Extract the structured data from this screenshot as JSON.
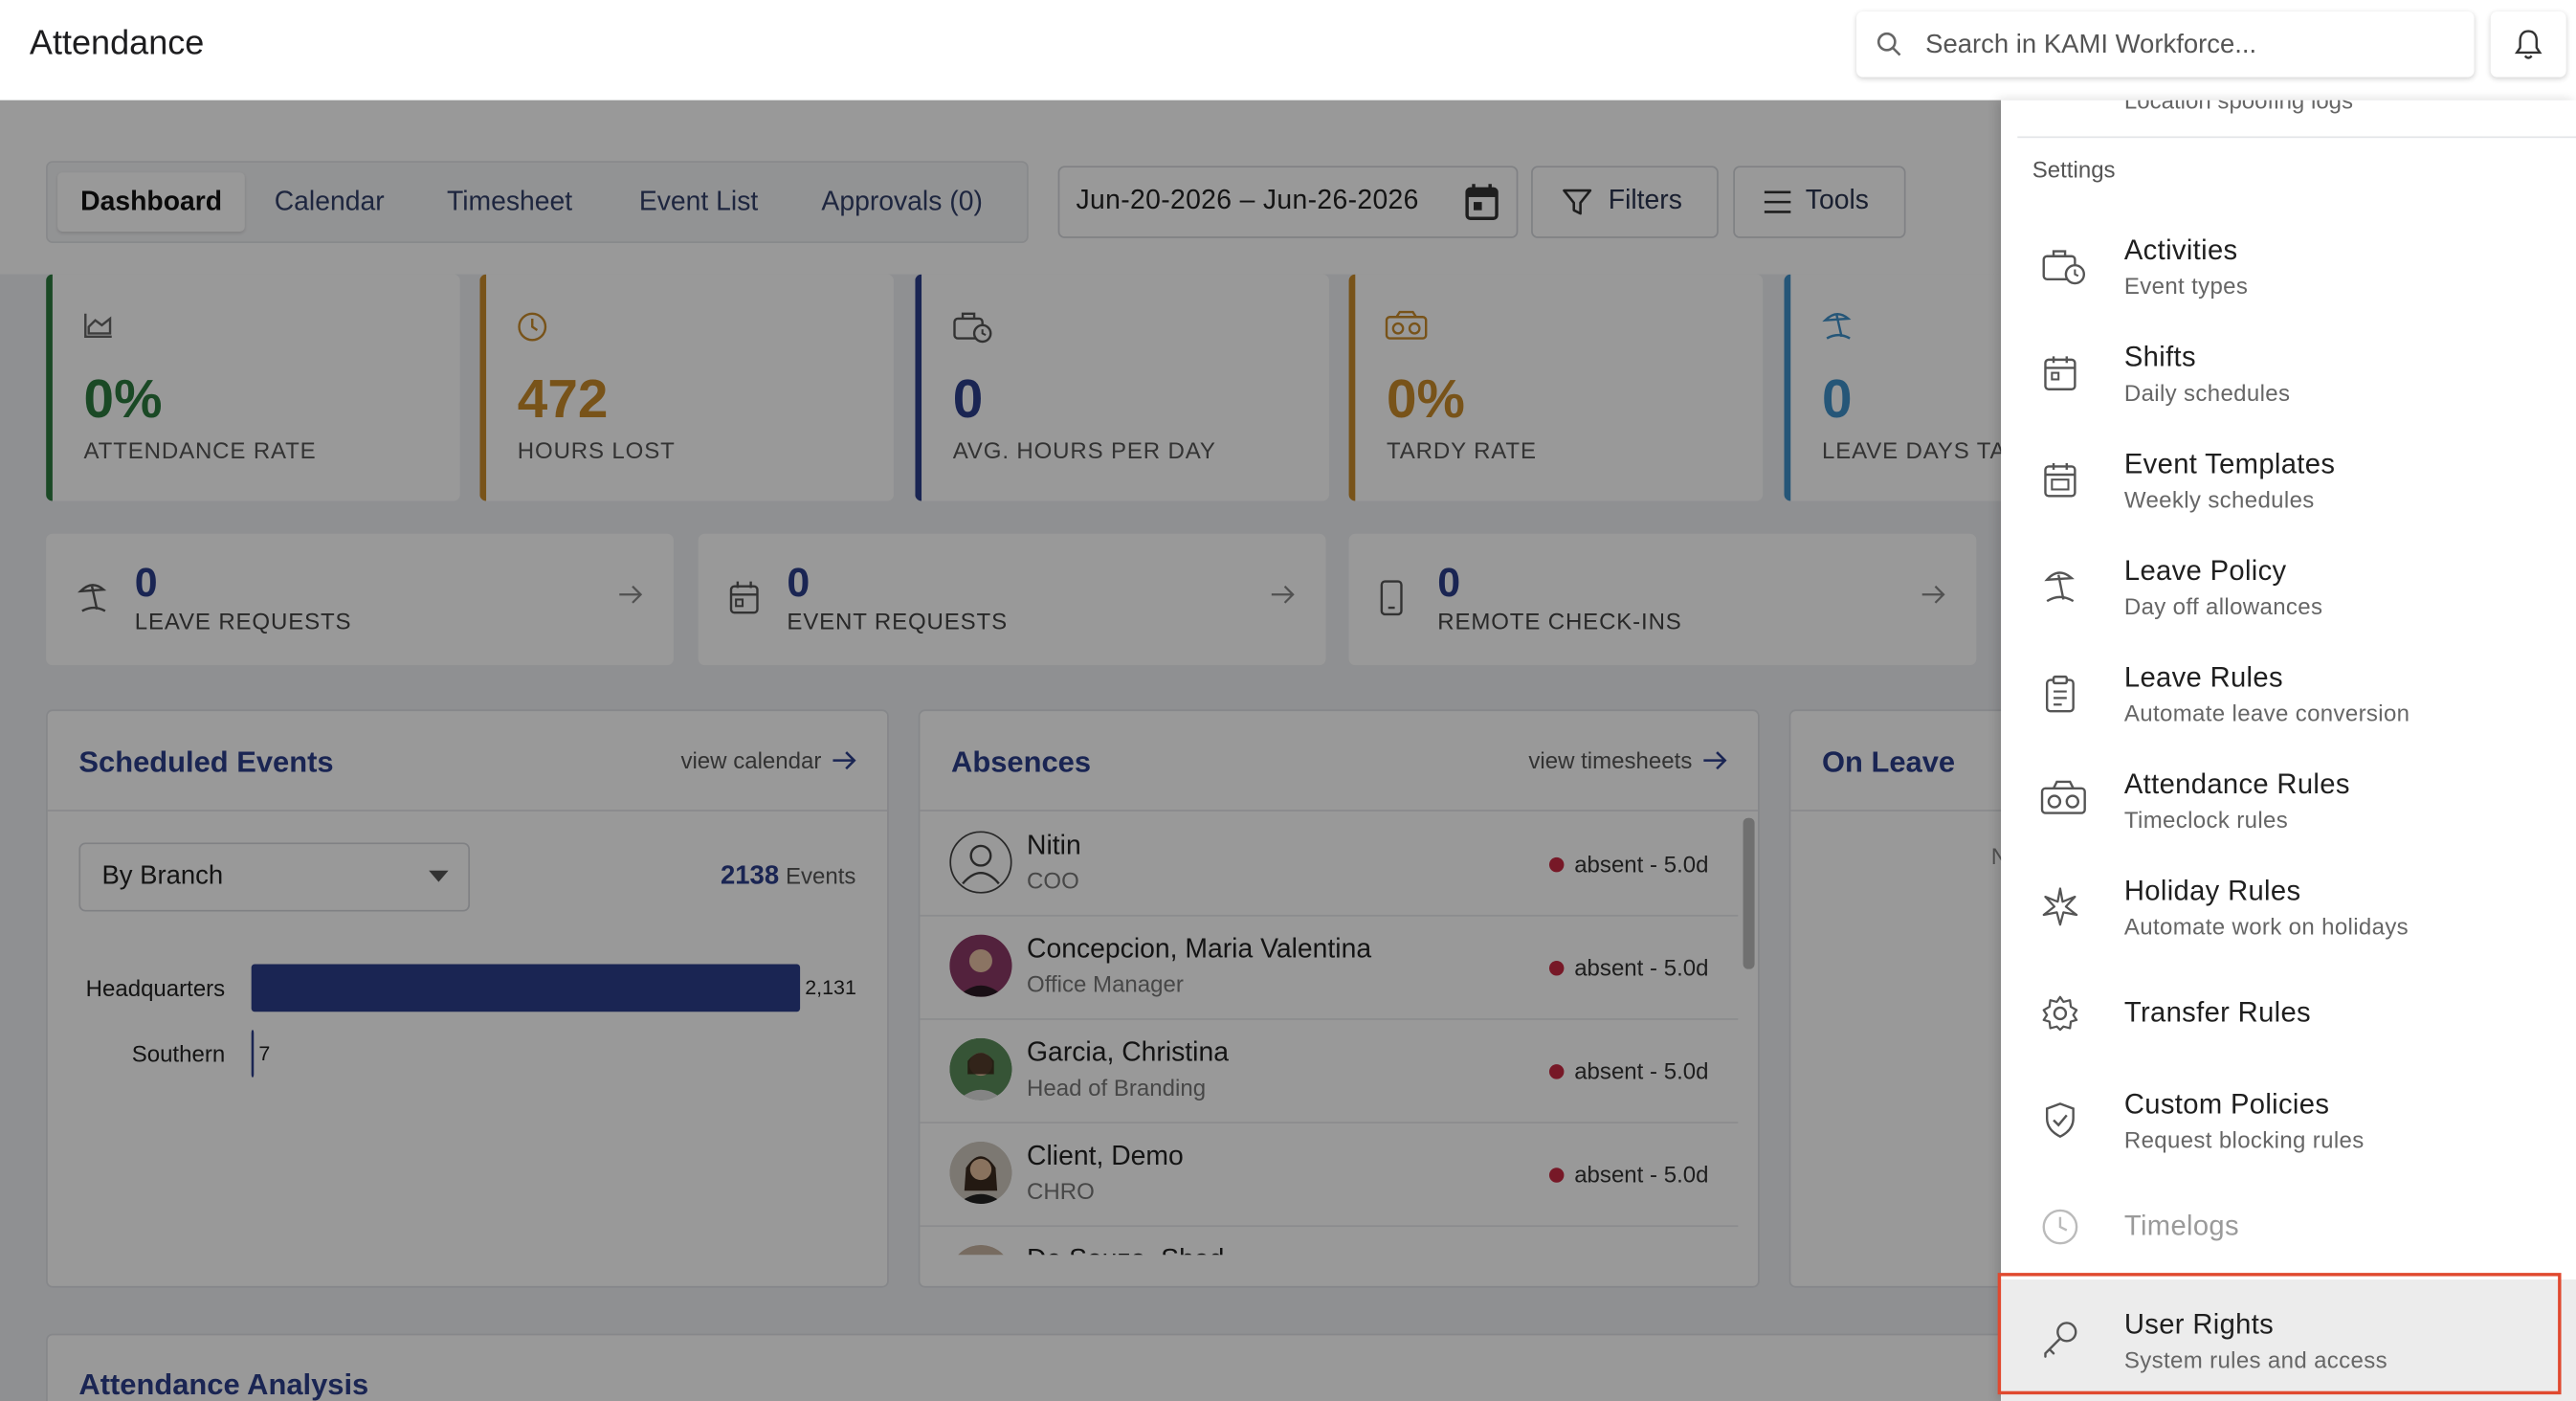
{
  "header": {
    "title": "Attendance",
    "search_placeholder": "Search in KAMI Workforce..."
  },
  "tabs": [
    {
      "label": "Dashboard",
      "active": true
    },
    {
      "label": "Calendar"
    },
    {
      "label": "Timesheet"
    },
    {
      "label": "Event List"
    },
    {
      "label": "Approvals (0)"
    }
  ],
  "toolbar": {
    "date_range": "Jun-20-2026 – Jun-26-2026",
    "filters_label": "Filters",
    "tools_label": "Tools"
  },
  "kpis": [
    {
      "value": "0%",
      "label": "ATTENDANCE RATE",
      "color": "#2c7a3f",
      "icon": "chart-area-icon"
    },
    {
      "value": "472",
      "label": "HOURS LOST",
      "color": "#c98a2b",
      "icon": "clock-icon"
    },
    {
      "value": "0",
      "label": "AVG. HOURS PER DAY",
      "color": "#2c3e8a",
      "icon": "briefcase-clock-icon"
    },
    {
      "value": "0%",
      "label": "TARDY RATE",
      "color": "#c98a2b",
      "icon": "cassette-icon"
    },
    {
      "value": "0",
      "label": "LEAVE DAYS TAK",
      "color": "#3f8fc9",
      "icon": "beach-icon"
    }
  ],
  "requests": [
    {
      "value": "0",
      "label": "LEAVE REQUESTS",
      "icon": "beach-icon"
    },
    {
      "value": "0",
      "label": "EVENT REQUESTS",
      "icon": "calendar-icon"
    },
    {
      "value": "0",
      "label": "REMOTE CHECK-INS",
      "icon": "phone-icon"
    }
  ],
  "scheduled": {
    "title": "Scheduled Events",
    "link": "view calendar",
    "select_value": "By Branch",
    "events_count": "2138",
    "events_label": "Events"
  },
  "chart_data": {
    "type": "bar",
    "orientation": "horizontal",
    "categories": [
      "Headquarters",
      "Southern"
    ],
    "values": [
      2131,
      7
    ],
    "value_labels": [
      "2,131",
      "7"
    ],
    "xlim": [
      0,
      2131
    ],
    "bar_color": "#2c3e8a"
  },
  "absences": {
    "title": "Absences",
    "link": "view timesheets",
    "status_text": "absent - 5.0d",
    "rows": [
      {
        "name": "Nitin",
        "role": "COO"
      },
      {
        "name": "Concepcion, Maria Valentina",
        "role": "Office Manager"
      },
      {
        "name": "Garcia, Christina",
        "role": "Head of Branding"
      },
      {
        "name": "Client, Demo",
        "role": "CHRO"
      },
      {
        "name": "De Souza, Shad",
        "role": ""
      }
    ]
  },
  "on_leave": {
    "title": "On Leave",
    "partial": "N"
  },
  "analysis": {
    "title": "Attendance Analysis"
  },
  "panel": {
    "cut_text": "Location spoofing logs",
    "section": "Settings",
    "items": [
      {
        "title": "Activities",
        "subtitle": "Event types",
        "icon": "briefcase-clock-icon"
      },
      {
        "title": "Shifts",
        "subtitle": "Daily schedules",
        "icon": "calendar-icon"
      },
      {
        "title": "Event Templates",
        "subtitle": "Weekly schedules",
        "icon": "calendar-template-icon"
      },
      {
        "title": "Leave Policy",
        "subtitle": "Day off allowances",
        "icon": "beach-icon"
      },
      {
        "title": "Leave Rules",
        "subtitle": "Automate leave conversion",
        "icon": "clipboard-list-icon"
      },
      {
        "title": "Attendance Rules",
        "subtitle": "Timeclock rules",
        "icon": "cassette-icon"
      },
      {
        "title": "Holiday Rules",
        "subtitle": "Automate work on holidays",
        "icon": "sparkle-icon"
      },
      {
        "title": "Transfer Rules",
        "subtitle": "",
        "icon": "gear-icon"
      },
      {
        "title": "Custom Policies",
        "subtitle": "Request blocking rules",
        "icon": "shield-check-icon"
      },
      {
        "title": "Timelogs",
        "subtitle": "",
        "icon": "clock-icon"
      },
      {
        "title": "User Rights",
        "subtitle": "System rules and access",
        "icon": "key-icon"
      }
    ]
  }
}
